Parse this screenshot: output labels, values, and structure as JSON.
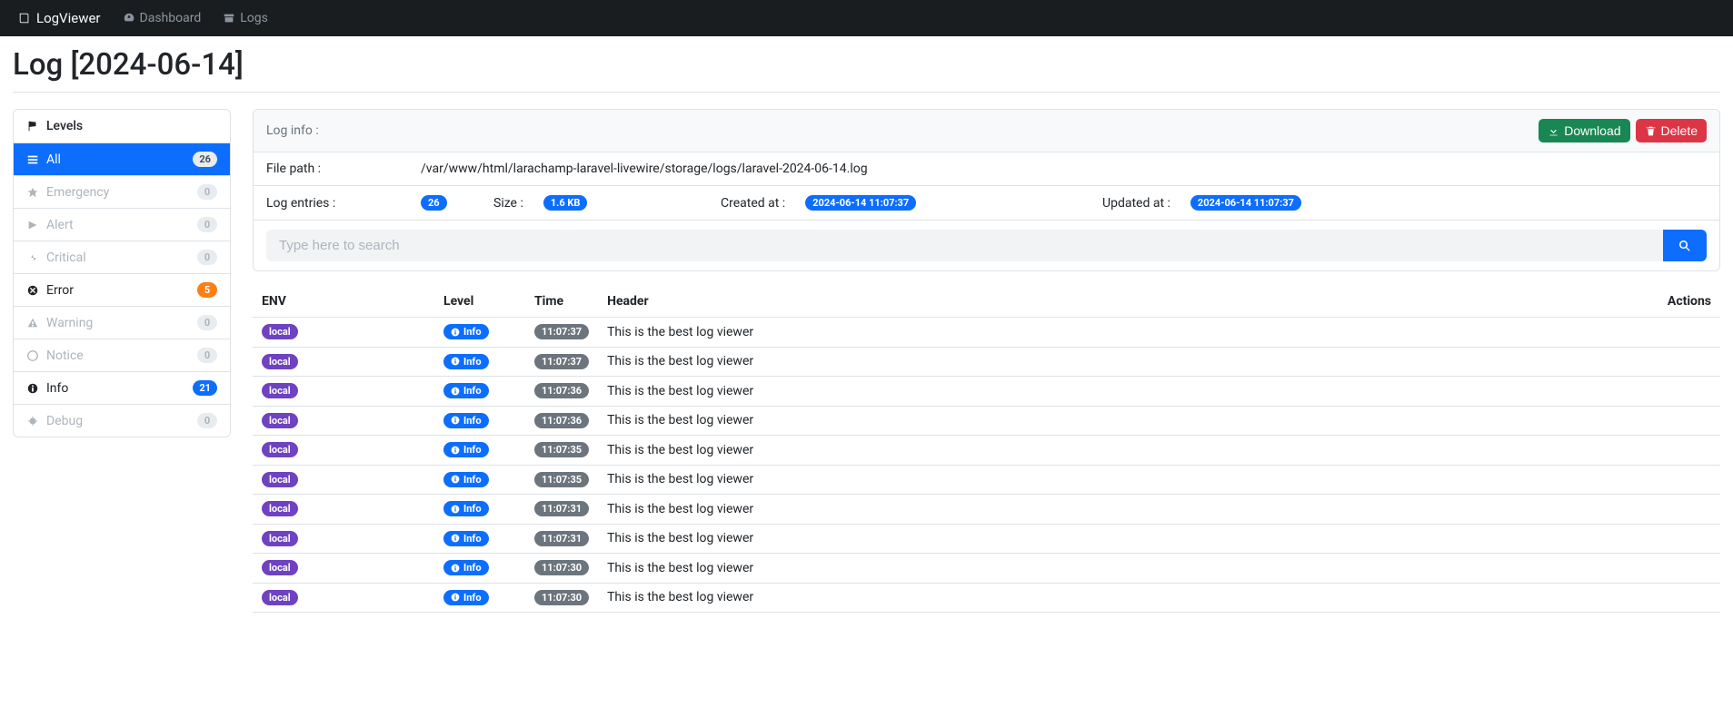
{
  "navbar": {
    "brand": "LogViewer",
    "dashboard": "Dashboard",
    "logs": "Logs"
  },
  "page_title": "Log [2024-06-14]",
  "sidebar": {
    "header": "Levels",
    "items": [
      {
        "label": "All",
        "count": "26",
        "state": "active"
      },
      {
        "label": "Emergency",
        "count": "0",
        "state": "muted"
      },
      {
        "label": "Alert",
        "count": "0",
        "state": "muted"
      },
      {
        "label": "Critical",
        "count": "0",
        "state": "muted"
      },
      {
        "label": "Error",
        "count": "5",
        "state": "error"
      },
      {
        "label": "Warning",
        "count": "0",
        "state": "muted"
      },
      {
        "label": "Notice",
        "count": "0",
        "state": "muted"
      },
      {
        "label": "Info",
        "count": "21",
        "state": "info"
      },
      {
        "label": "Debug",
        "count": "0",
        "state": "muted"
      }
    ]
  },
  "loginfo": {
    "header": "Log info :",
    "download": "Download",
    "delete": "Delete",
    "filepath_label": "File path :",
    "filepath_value": "/var/www/html/larachamp-laravel-livewire/storage/logs/laravel-2024-06-14.log",
    "entries_label": "Log entries :",
    "entries_value": "26",
    "size_label": "Size :",
    "size_value": "1.6 KB",
    "created_label": "Created at :",
    "created_value": "2024-06-14 11:07:37",
    "updated_label": "Updated at :",
    "updated_value": "2024-06-14 11:07:37"
  },
  "search": {
    "placeholder": "Type here to search"
  },
  "table": {
    "headers": {
      "env": "ENV",
      "level": "Level",
      "time": "Time",
      "header": "Header",
      "actions": "Actions"
    },
    "rows": [
      {
        "env": "local",
        "level": "Info",
        "time": "11:07:37",
        "header": "This is the best log viewer"
      },
      {
        "env": "local",
        "level": "Info",
        "time": "11:07:37",
        "header": "This is the best log viewer"
      },
      {
        "env": "local",
        "level": "Info",
        "time": "11:07:36",
        "header": "This is the best log viewer"
      },
      {
        "env": "local",
        "level": "Info",
        "time": "11:07:36",
        "header": "This is the best log viewer"
      },
      {
        "env": "local",
        "level": "Info",
        "time": "11:07:35",
        "header": "This is the best log viewer"
      },
      {
        "env": "local",
        "level": "Info",
        "time": "11:07:35",
        "header": "This is the best log viewer"
      },
      {
        "env": "local",
        "level": "Info",
        "time": "11:07:31",
        "header": "This is the best log viewer"
      },
      {
        "env": "local",
        "level": "Info",
        "time": "11:07:31",
        "header": "This is the best log viewer"
      },
      {
        "env": "local",
        "level": "Info",
        "time": "11:07:30",
        "header": "This is the best log viewer"
      },
      {
        "env": "local",
        "level": "Info",
        "time": "11:07:30",
        "header": "This is the best log viewer"
      }
    ]
  }
}
